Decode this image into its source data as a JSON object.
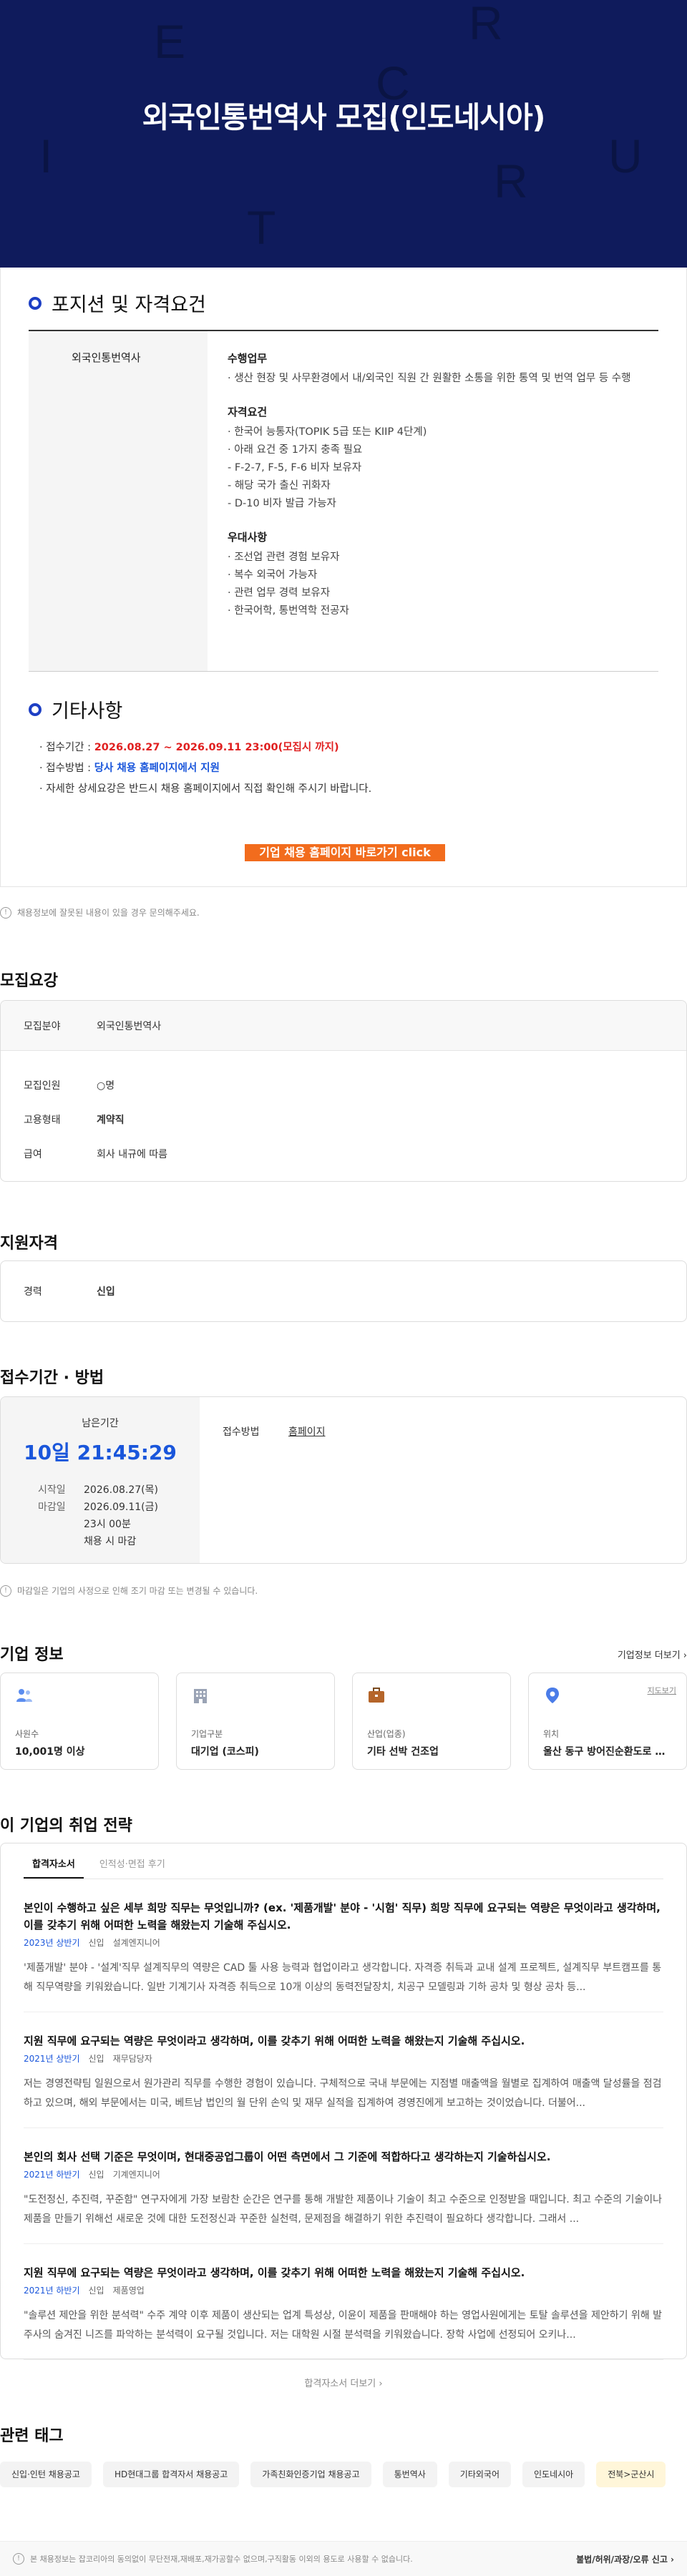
{
  "hero": {
    "title": "외국인통번역사 모집(인도네시아)",
    "letters": [
      "E",
      "R",
      "C",
      "U",
      "I",
      "T",
      "R"
    ]
  },
  "position": {
    "section_title": "포지션 및 자격요건",
    "role": "외국인통번역사",
    "duties_title": "수행업무",
    "duties": [
      "· 생산 현장 및 사무환경에서 내/외국인 직원 간 원활한 소통을 위한 통역 및 번역 업무 등 수행"
    ],
    "qual_title": "자격요건",
    "quals": [
      "· 한국어 능통자(TOPIK 5급 또는 KIIP 4단계)",
      "· 아래 요건 중 1가지 충족 필요",
      "  - F-2-7, F-5, F-6 비자 보유자",
      "  - 해당 국가 출신 귀화자",
      "  - D-10 비자 발급 가능자"
    ],
    "pref_title": "우대사항",
    "prefs": [
      "· 조선업 관련 경험 보유자",
      "· 복수 외국어 가능자",
      "· 관련 업무 경력 보유자",
      "· 한국어학, 통번역학 전공자"
    ]
  },
  "etc": {
    "section_title": "기타사항",
    "period_label": "· 접수기간 : ",
    "period_value": "2026.08.27 ~ 2026.09.11 23:00(모집시 까지)",
    "method_label": "· 접수방법 : ",
    "method_value": "당사 채용 홈페이지에서 지원",
    "detail": "· 자세한 상세요강은 반드시 채용 홈페이지에서 직접 확인해 주시기 바랍니다.",
    "cta": "기업 채용 홈페이지 바로가기 click"
  },
  "report_notice": "채용정보에 잘못된 내용이 있을 경우 문의해주세요.",
  "summary": {
    "title": "모집요강",
    "field_label": "모집분야",
    "field_value": "외국인통번역사",
    "count_label": "모집인원",
    "count_value": "○명",
    "type_label": "고용형태",
    "type_value": "계약직",
    "pay_label": "급여",
    "pay_value": "회사 내규에 따름"
  },
  "eligibility": {
    "title": "지원자격",
    "career_label": "경력",
    "career_value": "신입"
  },
  "apply": {
    "title": "접수기간 · 방법",
    "remain_label": "남은기간",
    "remain_value": "10일 21:45:29",
    "start_label": "시작일",
    "start_value": "2026.08.27(목)",
    "end_label": "마감일",
    "end_value": "2026.09.11(금)",
    "end_time": "23시 00분",
    "end_note": "채용 시 마감",
    "method_label": "접수방법",
    "method_value": "홈페이지",
    "note": "마감일은 기업의 사정으로 인해 조기 마감 또는 변경될 수 있습니다."
  },
  "company": {
    "title": "기업 정보",
    "more": "기업정보 더보기 ›",
    "cards": [
      {
        "label": "사원수",
        "value": "10,001명 이상",
        "icon": "people-icon"
      },
      {
        "label": "기업구분",
        "value": "대기업 (코스피)",
        "icon": "building-icon"
      },
      {
        "label": "산업(업종)",
        "value": "기타 선박 건조업",
        "icon": "briefcase-icon"
      },
      {
        "label": "위치",
        "value": "울산 동구 방어진순환도로 1000...",
        "icon": "location-pin-icon",
        "map": "지도보기"
      }
    ]
  },
  "strategy": {
    "title": "이 기업의 취업 전략",
    "tabs": [
      "합격자소서",
      "인적성·면접 후기"
    ],
    "items": [
      {
        "q": "본인이 수행하고 싶은 세부 희망 직무는 무엇입니까? (ex. '제품개발' 분야 - '시험' 직무) 희망 직무에 요구되는 역량은 무엇이라고 생각하며, 이를 갖추기 위해 어떠한 노력을 해왔는지 기술해 주십시오.",
        "year": "2023년 상반기",
        "kind": "신입",
        "dept": "설계엔지니어",
        "a": "'제품개발' 분야 - '설계'직무 설계직무의 역량은 CAD 툴 사용 능력과 협업이라고 생각합니다. 자격증 취득과 교내 설계 프로젝트, 설계직무 부트캠프를 통해 직무역량을 키워왔습니다. 일반 기계기사 자격증 취득으로 10개 이상의 동력전달장치, 치공구 모델링과 기하 공차 및 형상 공차 등..."
      },
      {
        "q": "지원 직무에 요구되는 역량은 무엇이라고 생각하며, 이를 갖추기 위해 어떠한 노력을 해왔는지 기술해 주십시오.",
        "year": "2021년 상반기",
        "kind": "신입",
        "dept": "재무담당자",
        "a": "저는 경영전략팀 일원으로서 원가관리 직무를 수행한 경험이 있습니다. 구체적으로 국내 부문에는 지점별 매출액을 월별로 집계하여 매출액 달성률을 점검하고 있으며, 해외 부문에서는 미국, 베트남 법인의 월 단위 손익 및 재무 실적을 집계하여 경영진에게 보고하는 것이었습니다. 더불어..."
      },
      {
        "q": "본인의 회사 선택 기준은 무엇이며, 현대중공업그룹이 어떤 측면에서 그 기준에 적합하다고 생각하는지 기술하십시오.",
        "year": "2021년 하반기",
        "kind": "신입",
        "dept": "기계엔지니어",
        "a": "\"도전정신, 추진력, 꾸준함\" 연구자에게 가장 보람찬 순간은 연구를 통해 개발한 제품이나 기술이 최고 수준으로 인정받을 때입니다. 최고 수준의 기술이나 제품을 만들기 위해선 새로운 것에 대한 도전정신과 꾸준한 실천력, 문제점을 해결하기 위한 추진력이 필요하다 생각합니다. 그래서 ..."
      },
      {
        "q": "지원 직무에 요구되는 역량은 무엇이라고 생각하며, 이를 갖추기 위해 어떠한 노력을 해왔는지 기술해 주십시오.",
        "year": "2021년 하반기",
        "kind": "신입",
        "dept": "제품영업",
        "a": "\"솔루션 제안을 위한 분석력\" 수주 계약 이후 제품이 생산되는 업계 특성상, 이윤이 제품을 판매해야 하는 영업사원에게는 토탈 솔루션을 제안하기 위해 발주사의 숨겨진 니즈를 파악하는 분석력이 요구될 것입니다. 저는 대학원 시절 분석력을 키워왔습니다. 장학 사업에 선정되어 오키나..."
      }
    ],
    "more": "합격자소서 더보기 ›"
  },
  "tags": {
    "title": "관련 태그",
    "items": [
      "신입·인턴 채용공고",
      "HD현대그룹 합격자서 채용공고",
      "가족친화인증기업 채용공고",
      "통번역사",
      "기타외국어",
      "인도네시아",
      "전북>군산시"
    ]
  },
  "footer": {
    "left": "본 채용정보는 잡코리아의 동의없이 무단전재,재배포,재가공할수 없으며,구직활동 이외의 용도로 사용할 수 없습니다.",
    "right": "불법/허위/과장/오류 신고 ›"
  }
}
